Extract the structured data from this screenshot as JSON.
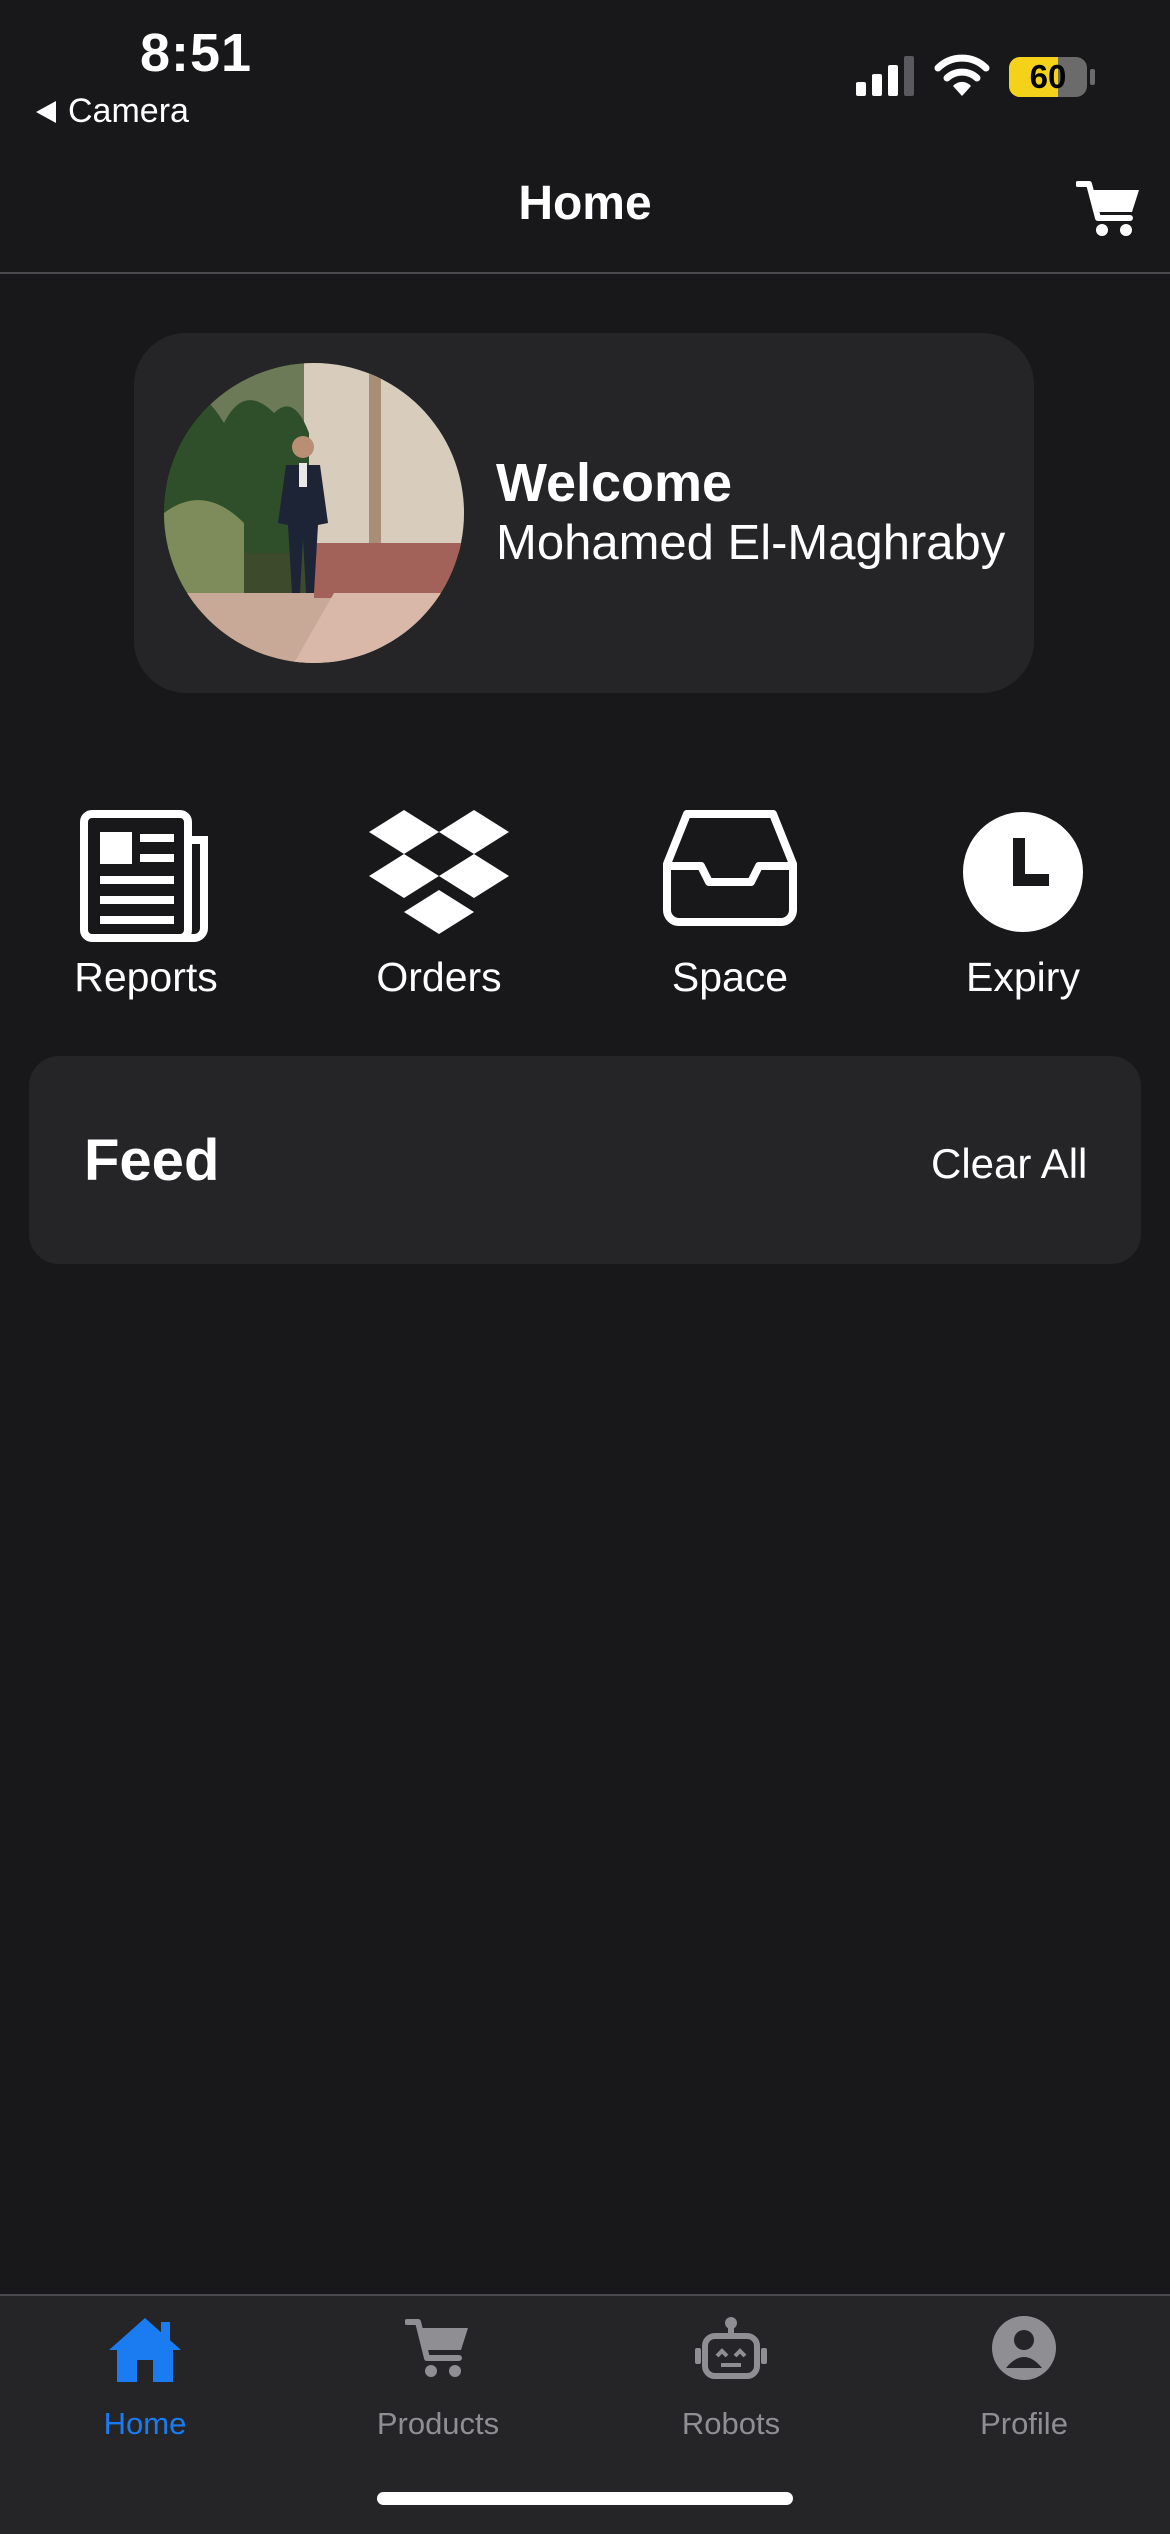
{
  "status_bar": {
    "time": "8:51",
    "back_label": "Camera",
    "battery": "60"
  },
  "nav": {
    "title": "Home",
    "cart_icon": "cart-icon"
  },
  "welcome": {
    "title": "Welcome",
    "name": "Mohamed El-Maghraby"
  },
  "actions": [
    {
      "label": "Reports",
      "icon": "newspaper-icon"
    },
    {
      "label": "Orders",
      "icon": "dropbox-icon"
    },
    {
      "label": "Space",
      "icon": "inbox-tray-icon"
    },
    {
      "label": "Expiry",
      "icon": "clock-icon"
    }
  ],
  "feed": {
    "title": "Feed",
    "clear_label": "Clear All"
  },
  "tabs": [
    {
      "label": "Home",
      "icon": "home-icon",
      "active": true
    },
    {
      "label": "Products",
      "icon": "cart-icon",
      "active": false
    },
    {
      "label": "Robots",
      "icon": "robot-icon",
      "active": false
    },
    {
      "label": "Profile",
      "icon": "person-circle-icon",
      "active": false
    }
  ],
  "colors": {
    "background": "#18181a",
    "card": "#252528",
    "accent": "#1a7cf0",
    "inactive_tab": "#8e8e93",
    "battery_fill": "#f5d21a"
  }
}
